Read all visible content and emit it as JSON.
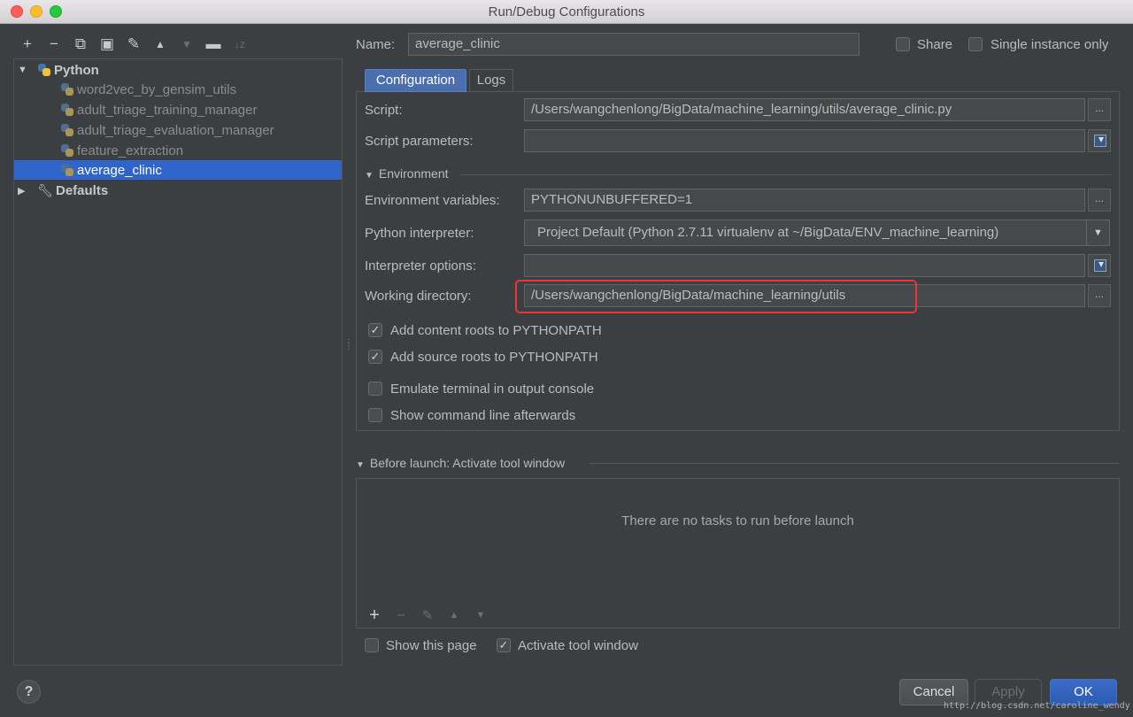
{
  "window": {
    "title": "Run/Debug Configurations"
  },
  "toolbar": {
    "add": "+",
    "remove": "−",
    "copy": "⧉",
    "save": "▣",
    "edit_defaults": "✎",
    "move_up": "▲",
    "move_down": "▼",
    "folder": "▬",
    "sort": "↓z"
  },
  "tree": {
    "python_label": "Python",
    "items": [
      {
        "label": "word2vec_by_gensim_utils"
      },
      {
        "label": "adult_triage_training_manager"
      },
      {
        "label": "adult_triage_evaluation_manager"
      },
      {
        "label": "feature_extraction"
      },
      {
        "label": "average_clinic"
      }
    ],
    "defaults_label": "Defaults"
  },
  "header": {
    "name_label": "Name:",
    "name_value": "average_clinic",
    "share_label": "Share",
    "single_instance_label": "Single instance only"
  },
  "tabs": {
    "configuration": "Configuration",
    "logs": "Logs"
  },
  "config": {
    "script_label": "Script:",
    "script_value": "/Users/wangchenlong/BigData/machine_learning/utils/average_clinic.py",
    "script_params_label": "Script parameters:",
    "script_params_value": "",
    "environment_section": "Environment",
    "env_vars_label": "Environment variables:",
    "env_vars_value": "PYTHONUNBUFFERED=1",
    "interpreter_label": "Python interpreter:",
    "interpreter_value": "Project Default (Python 2.7.11 virtualenv at ~/BigData/ENV_machine_learning)",
    "interp_options_label": "Interpreter options:",
    "interp_options_value": "",
    "workdir_label": "Working directory:",
    "workdir_value": "/Users/wangchenlong/BigData/machine_learning/utils",
    "browse": "...",
    "checkboxes": {
      "content_roots": {
        "label": "Add content roots to PYTHONPATH",
        "checked": true
      },
      "source_roots": {
        "label": "Add source roots to PYTHONPATH",
        "checked": true
      },
      "emulate_terminal": {
        "label": "Emulate terminal in output console",
        "checked": false
      },
      "show_cmdline": {
        "label": "Show command line afterwards",
        "checked": false
      }
    }
  },
  "before_launch": {
    "title": "Before launch: Activate tool window",
    "empty_message": "There are no tasks to run before launch",
    "add": "+",
    "remove": "−",
    "edit": "✎",
    "up": "▲",
    "down": "▼",
    "show_page_label": "Show this page",
    "activate_label": "Activate tool window"
  },
  "footer": {
    "help": "?",
    "cancel": "Cancel",
    "apply": "Apply",
    "ok": "OK",
    "watermark": "http://blog.csdn.net/caroline_wendy"
  },
  "colors": {
    "selection": "#2f65ca",
    "highlight_box": "#e8363b",
    "ok_button": "#2f5fb8"
  }
}
